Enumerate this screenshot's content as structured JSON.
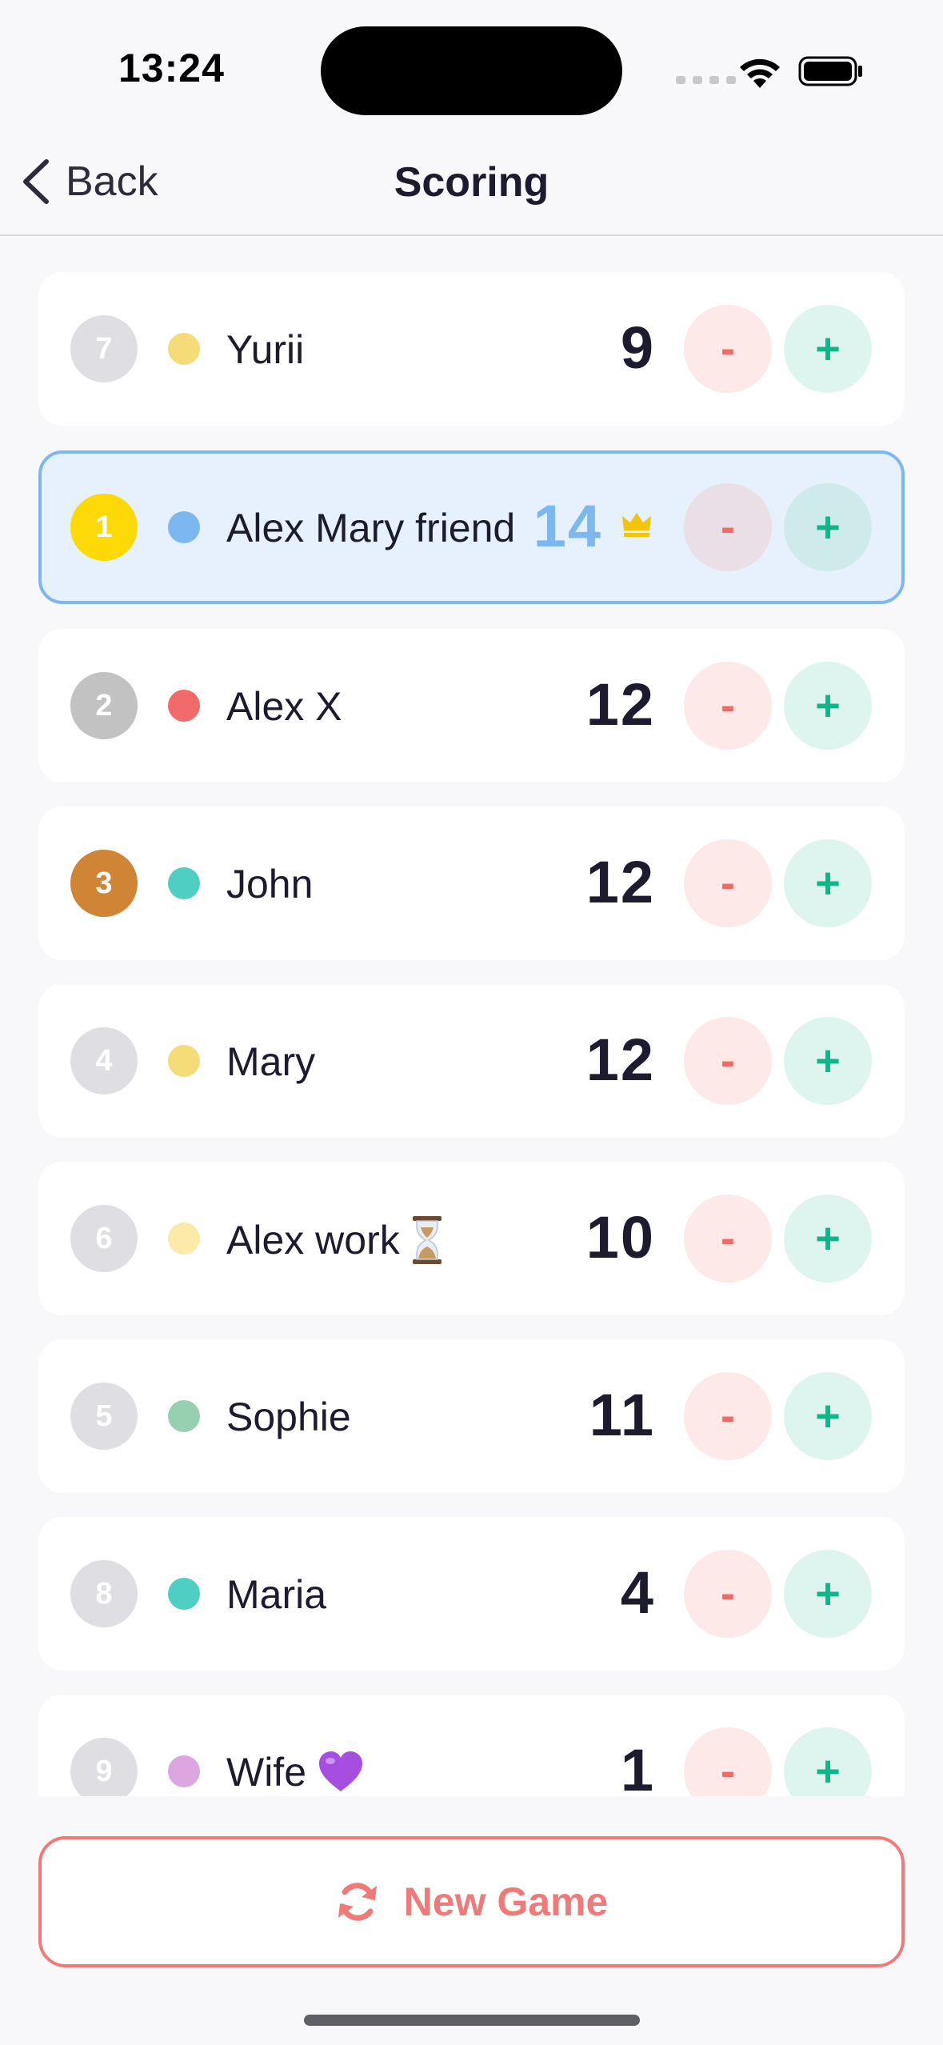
{
  "status_bar": {
    "time": "13:24"
  },
  "nav": {
    "back_label": "Back",
    "title": "Scoring"
  },
  "colors": {
    "minus_bg": "#fde9e8",
    "minus_fg": "#f06a66",
    "plus_bg": "#def5ef",
    "plus_fg": "#13b48a",
    "leader_bg": "#e6f1fd",
    "leader_border": "#7cb7f0",
    "accent_red": "#f07a78"
  },
  "players": [
    {
      "rank": "7",
      "rank_color": "#dedee3",
      "dot_color": "#f5dc79",
      "name": "Yurii",
      "score": "9",
      "minus": "-",
      "plus": "+"
    },
    {
      "rank": "1",
      "rank_color": "#fed908",
      "dot_color": "#7cb7f0",
      "name": "Alex Mary friend",
      "score": "14",
      "minus": "-",
      "plus": "+",
      "leader": true,
      "badge_icon": "crown-icon"
    },
    {
      "rank": "2",
      "rank_color": "#c2c2c2",
      "dot_color": "#f26b6b",
      "name": "Alex X",
      "score": "12",
      "minus": "-",
      "plus": "+"
    },
    {
      "rank": "3",
      "rank_color": "#cf8436",
      "dot_color": "#4fcfc4",
      "name": "John",
      "score": "12",
      "minus": "-",
      "plus": "+"
    },
    {
      "rank": "4",
      "rank_color": "#dedee3",
      "dot_color": "#f5dc79",
      "name": "Mary",
      "score": "12",
      "minus": "-",
      "plus": "+"
    },
    {
      "rank": "6",
      "rank_color": "#dedee3",
      "dot_color": "#fbeaa8",
      "name": "Alex work",
      "score": "10",
      "minus": "-",
      "plus": "+",
      "emoji_icon": "hourglass-icon"
    },
    {
      "rank": "5",
      "rank_color": "#dedee3",
      "dot_color": "#97d0b1",
      "name": "Sophie",
      "score": "11",
      "minus": "-",
      "plus": "+"
    },
    {
      "rank": "8",
      "rank_color": "#dedee3",
      "dot_color": "#4fcfc4",
      "name": "Maria",
      "score": "4",
      "minus": "-",
      "plus": "+"
    },
    {
      "rank": "9",
      "rank_color": "#dedee3",
      "dot_color": "#dca6e0",
      "name": "Wife",
      "score": "1",
      "minus": "-",
      "plus": "+",
      "emoji_icon": "purple-heart-icon"
    }
  ],
  "footer": {
    "new_game_label": "New Game"
  }
}
